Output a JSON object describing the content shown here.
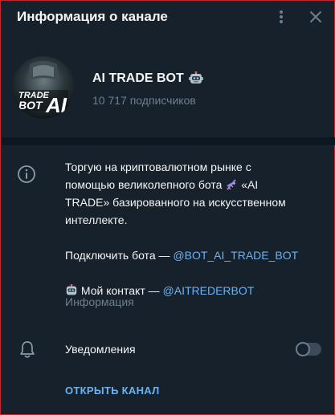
{
  "header": {
    "title": "Информация о канале",
    "more_icon": "more-vertical-icon",
    "close_icon": "close-icon"
  },
  "profile": {
    "avatar_text_1": "TRADE",
    "avatar_text_2": "BOT",
    "avatar_text_3": "AI",
    "name": "AI TRADE BOT",
    "name_emoji": "robot-icon",
    "subscribers": "10 717 подписчиков"
  },
  "description": {
    "line_1": "Торгую на криптовалютном рынке с",
    "line_2a": "помощью великолепного бота",
    "line_2b": "«AI",
    "line_3": "TRADE» базированного на искусственном",
    "line_4": "интеллекте.",
    "connect_prefix": "Подключить бота — ",
    "connect_link": "@BOT_AI_TRADE_BOT",
    "contact_prefix": " Мой контакт — ",
    "contact_link": "@AITREDERBOT",
    "info_label": "Информация"
  },
  "notifications": {
    "label": "Уведомления",
    "enabled": false
  },
  "actions": {
    "open_channel": "ОТКРЫТЬ КАНАЛ"
  },
  "colors": {
    "background": "#17212b",
    "accent": "#6ab2f2",
    "muted": "#6d7f8f",
    "border": "#c1272d"
  }
}
